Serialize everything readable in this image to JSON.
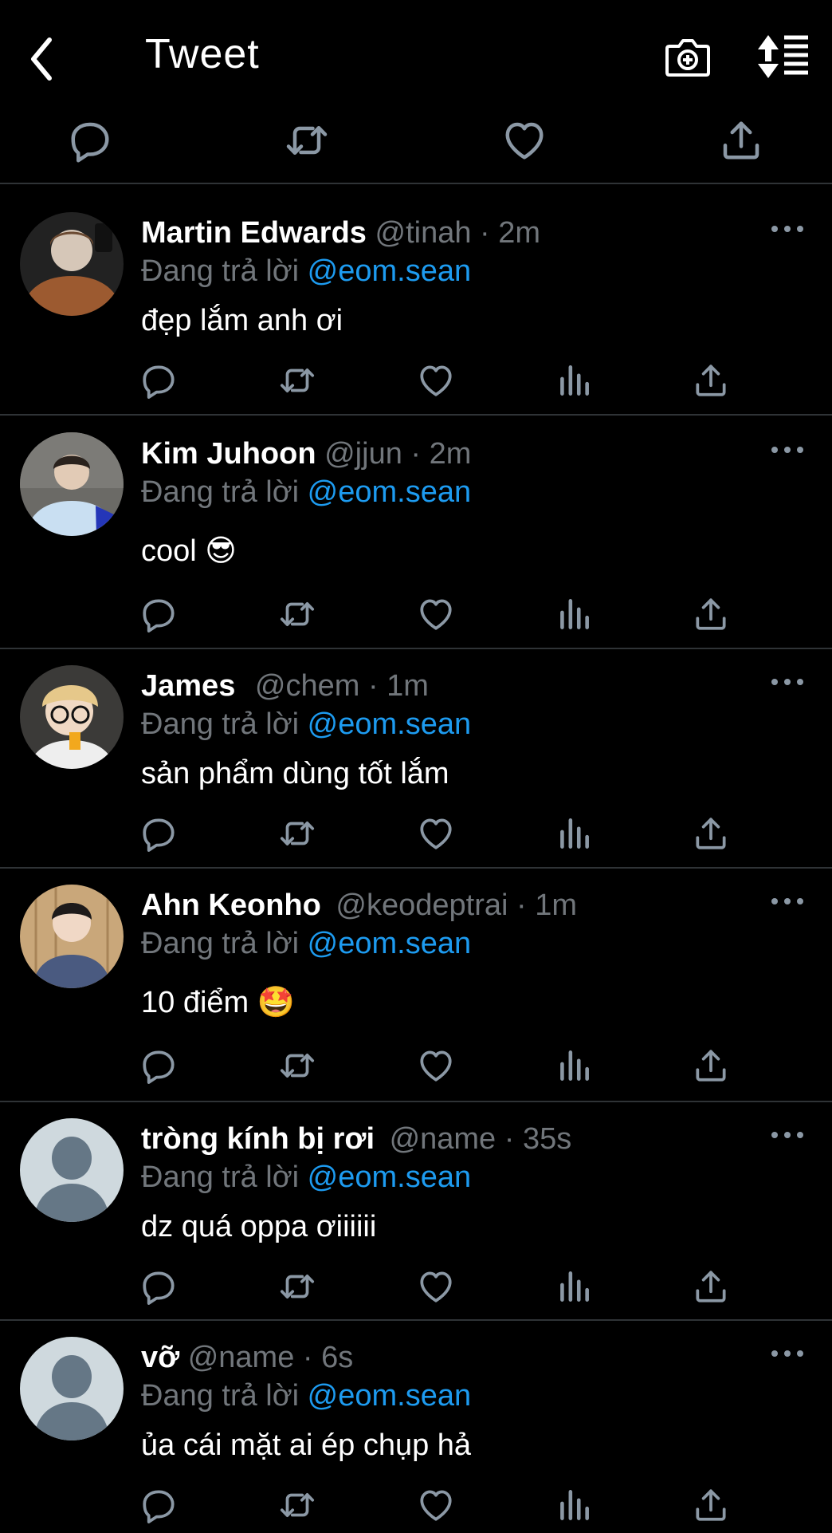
{
  "header": {
    "title": "Tweet"
  },
  "tweets": [
    {
      "name": "Martin Edwards",
      "handle": "@tinah",
      "time": "2m",
      "reply_prefix": "Đang trả lời",
      "reply_to": "@eom.sean",
      "text": "đẹp lắm anh ơi",
      "emoji": "",
      "avatar": "photo-brown-hoodie"
    },
    {
      "name": "Kim Juhoon",
      "handle": "@jjun",
      "time": "2m",
      "reply_prefix": "Đang trả lời",
      "reply_to": "@eom.sean",
      "text": "cool",
      "emoji": "😎",
      "avatar": "photo-white-shirt"
    },
    {
      "name": "James",
      "handle": "@chem",
      "time": "1m",
      "reply_prefix": "Đang trả lời",
      "reply_to": "@eom.sean",
      "text": "sản phẩm dùng tốt lắm",
      "emoji": "",
      "avatar": "photo-glasses"
    },
    {
      "name": "Ahn Keonho",
      "handle": "@keodeptrai",
      "time": "1m",
      "reply_prefix": "Đang trả lời",
      "reply_to": "@eom.sean",
      "text": "10 điểm",
      "emoji": "🤩",
      "avatar": "photo-blue-tank"
    },
    {
      "name": "tròng kính bị rơi",
      "handle": "@name",
      "time": "35s",
      "reply_prefix": "Đang trả lời",
      "reply_to": "@eom.sean",
      "text": "dz quá oppa ơiiiiii",
      "emoji": "",
      "avatar": "default-avatar"
    },
    {
      "name": "vỡ",
      "handle": "@name",
      "time": "6s",
      "reply_prefix": "Đang trả lời",
      "reply_to": "@eom.sean",
      "text": "ủa cái mặt ai ép chụp hả",
      "emoji": "",
      "avatar": "default-avatar"
    }
  ],
  "colors": {
    "background": "#000000",
    "accent": "#1d9bf0",
    "muted": "#71767b",
    "divider": "#2f3336"
  }
}
